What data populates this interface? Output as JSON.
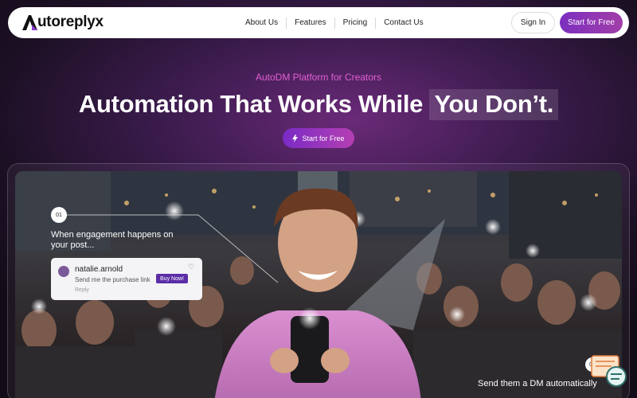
{
  "brand": {
    "name": "utoreplyx"
  },
  "nav": {
    "links": [
      "About Us",
      "Features",
      "Pricing",
      "Contact Us"
    ],
    "signin_label": "Sign In",
    "start_label": "Start for Free"
  },
  "hero": {
    "eyebrow": "AutoDM Platform for Creators",
    "headline_main": "Automation That Works While",
    "headline_highlight": "You Don’t.",
    "cta_label": "Start for Free",
    "cta_icon": "bolt-icon"
  },
  "flow": {
    "step1": {
      "number": "01",
      "text": "When engagement happens on your post..."
    },
    "comment": {
      "username": "natalie.arnold",
      "message": "Send me the purchase link",
      "button": "Buy Now!",
      "reply": "Reply"
    },
    "step2": {
      "number": "02",
      "text": "Send them a DM automatically"
    }
  },
  "colors": {
    "accent_pink": "#e15fd2",
    "button_purple": "#7b2fbf",
    "background_dark": "#1c1024"
  }
}
